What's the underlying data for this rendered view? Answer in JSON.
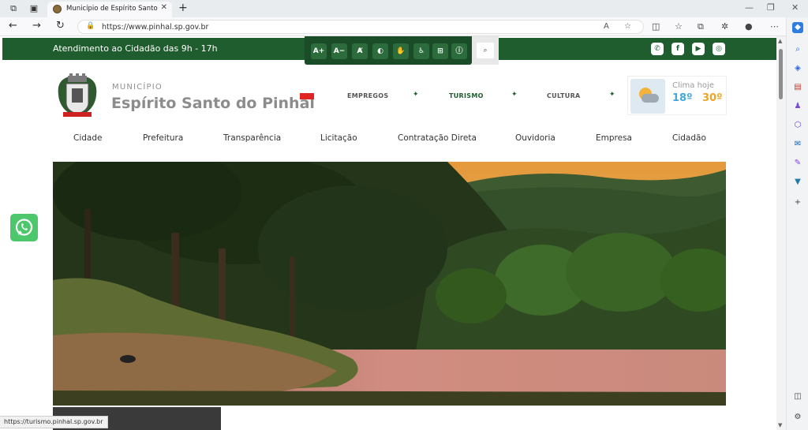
{
  "browser": {
    "tab_title": "Município de Espírito Santo do Pinhal",
    "url": "https://www.pinhal.sp.gov.br",
    "status_url": "https://turismo.pinhal.sp.gov.br"
  },
  "site": {
    "attendance": "Atendimento ao Cidadão das 9h - 17h",
    "accessibility": [
      "A+",
      "A−"
    ],
    "municipio": "MUNICÍPIO",
    "city": "Espírito Santo do Pinhal",
    "quick_links": [
      "EMPREGOS",
      "TURISMO",
      "CULTURA"
    ],
    "weather": {
      "label": "Clima hoje",
      "min": "18º",
      "max": "30º"
    },
    "nav": [
      "Cidade",
      "Prefeitura",
      "Transparência",
      "Licitação",
      "Contratação Direta",
      "Ouvidoria",
      "Empresa",
      "Cidadão"
    ]
  },
  "colors": {
    "brand_green": "#1f5c2e",
    "arrow_red": "#e02424",
    "weather_min": "#41a9d8",
    "weather_max": "#f0a424"
  },
  "icons": [
    "whatsapp-icon",
    "facebook-icon",
    "youtube-icon",
    "instagram-icon",
    "search-icon",
    "contrast-icon",
    "libras-icon",
    "accessibility-icon",
    "sitemap-icon",
    "info-icon"
  ]
}
